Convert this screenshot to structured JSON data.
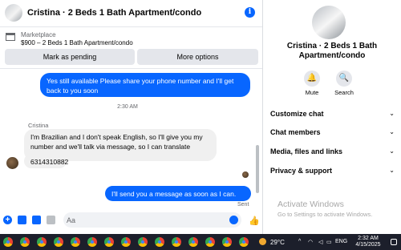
{
  "header": {
    "title": "Cristina · 2 Beds 1 Bath Apartment/condo",
    "info_glyph": "i"
  },
  "listing": {
    "label": "Marketplace",
    "description": "$900 – 2 Beds 1 Bath Apartment/condo",
    "mark_pending_label": "Mark as pending",
    "more_options_label": "More options"
  },
  "messages": {
    "outgoing_1": "Yes still available Please share your phone number and I'll get back to you soon",
    "timestamp": "2:30 AM",
    "sender_name": "Cristina",
    "incoming_1": "I'm Brazilian and I don't speak English, so I'll give you my number and we'll talk via message, so I can translate",
    "incoming_2": "6314310882",
    "outgoing_2": "I'll send you a message as soon as I can. Thanks",
    "status": "Sent"
  },
  "composer": {
    "placeholder": "Aa",
    "icons": [
      "plus-icon",
      "image-icon",
      "sticker-icon",
      "gif-icon",
      "emoji-icon",
      "like-icon"
    ]
  },
  "details": {
    "title": "Cristina · 2 Beds 1 Bath Apartment/condo",
    "actions": [
      {
        "label": "Mute",
        "icon": "bell-icon"
      },
      {
        "label": "Search",
        "icon": "search-icon"
      }
    ],
    "sections": [
      "Customize chat",
      "Chat members",
      "Media, files and links",
      "Privacy & support"
    ]
  },
  "watermark": {
    "title": "Activate Windows",
    "subtitle": "Go to Settings to activate Windows."
  },
  "taskbar": {
    "temperature": "29°C",
    "language": "ENG",
    "time": "2:32 AM",
    "date": "4/15/2025"
  },
  "colors": {
    "accent": "#0866ff",
    "incoming_bubble": "#f0f0f0",
    "taskbar": "#1c1f2b"
  }
}
